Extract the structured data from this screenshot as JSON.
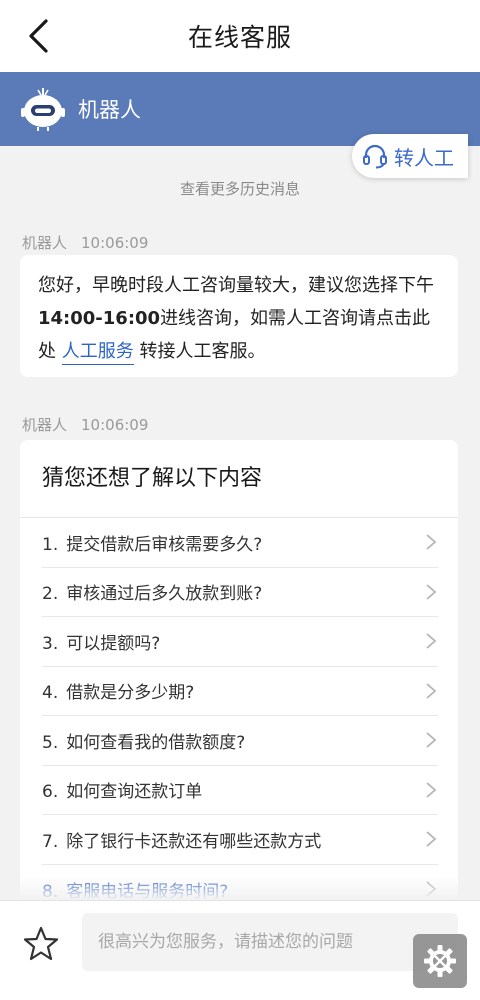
{
  "header": {
    "title": "在线客服"
  },
  "bot": {
    "name": "机器人"
  },
  "history_link": "查看更多历史消息",
  "messages": [
    {
      "sender": "机器人",
      "time": "10:06:09",
      "text_a": "您好，早晚时段人工咨询量较大，建议您选择下午",
      "text_bold": "14:00-16:00",
      "text_b": "进线咨询，如需人工咨询请点击此处 ",
      "link_text": "人工服务",
      "text_c": " 转接人工客服。"
    },
    {
      "sender": "机器人",
      "time": "10:06:09"
    }
  ],
  "transfer_button": {
    "label": "转人工"
  },
  "suggestions": {
    "title": "猜您还想了解以下内容",
    "items": [
      {
        "num": "1.",
        "text": "提交借款后审核需要多久?"
      },
      {
        "num": "2.",
        "text": "审核通过后多久放款到账?"
      },
      {
        "num": "3.",
        "text": "可以提额吗?"
      },
      {
        "num": "4.",
        "text": "借款是分多少期?"
      },
      {
        "num": "5.",
        "text": "如何查看我的借款额度?"
      },
      {
        "num": "6.",
        "text": "如何查询还款订单"
      },
      {
        "num": "7.",
        "text": "除了银行卡还款还有哪些还款方式"
      },
      {
        "num": "8.",
        "text": "客服电话与服务时间?"
      }
    ]
  },
  "input": {
    "placeholder": "很高兴为您服务，请描述您的问题"
  },
  "colors": {
    "brand": "#5a7ab8",
    "link": "#2f64c5",
    "background": "#f2f2f2"
  }
}
